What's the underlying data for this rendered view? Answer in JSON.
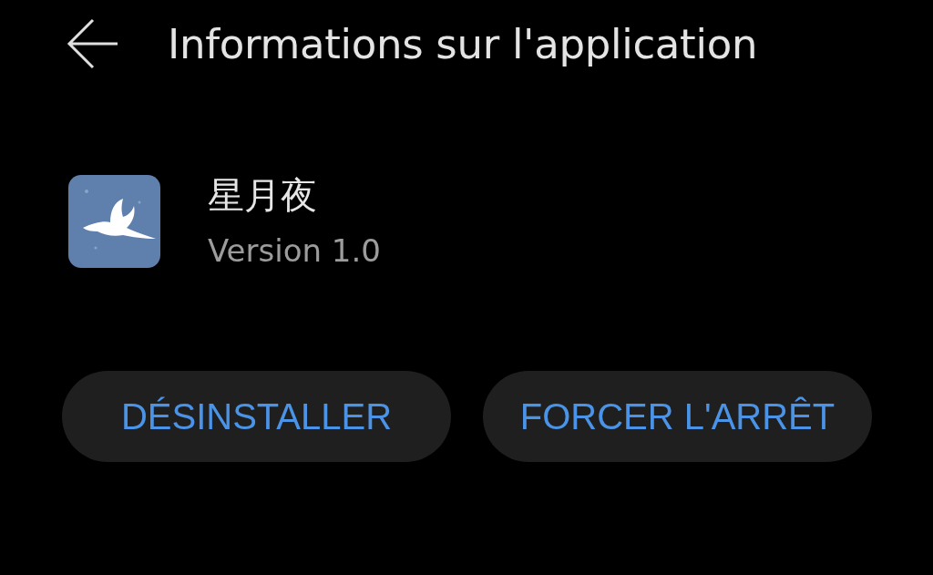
{
  "header": {
    "title": "Informations sur l'application"
  },
  "app": {
    "name": "星月夜",
    "version": "Version 1.0"
  },
  "buttons": [
    {
      "label": "DÉSINSTALLER"
    },
    {
      "label": "FORCER L'ARRÊT"
    }
  ]
}
